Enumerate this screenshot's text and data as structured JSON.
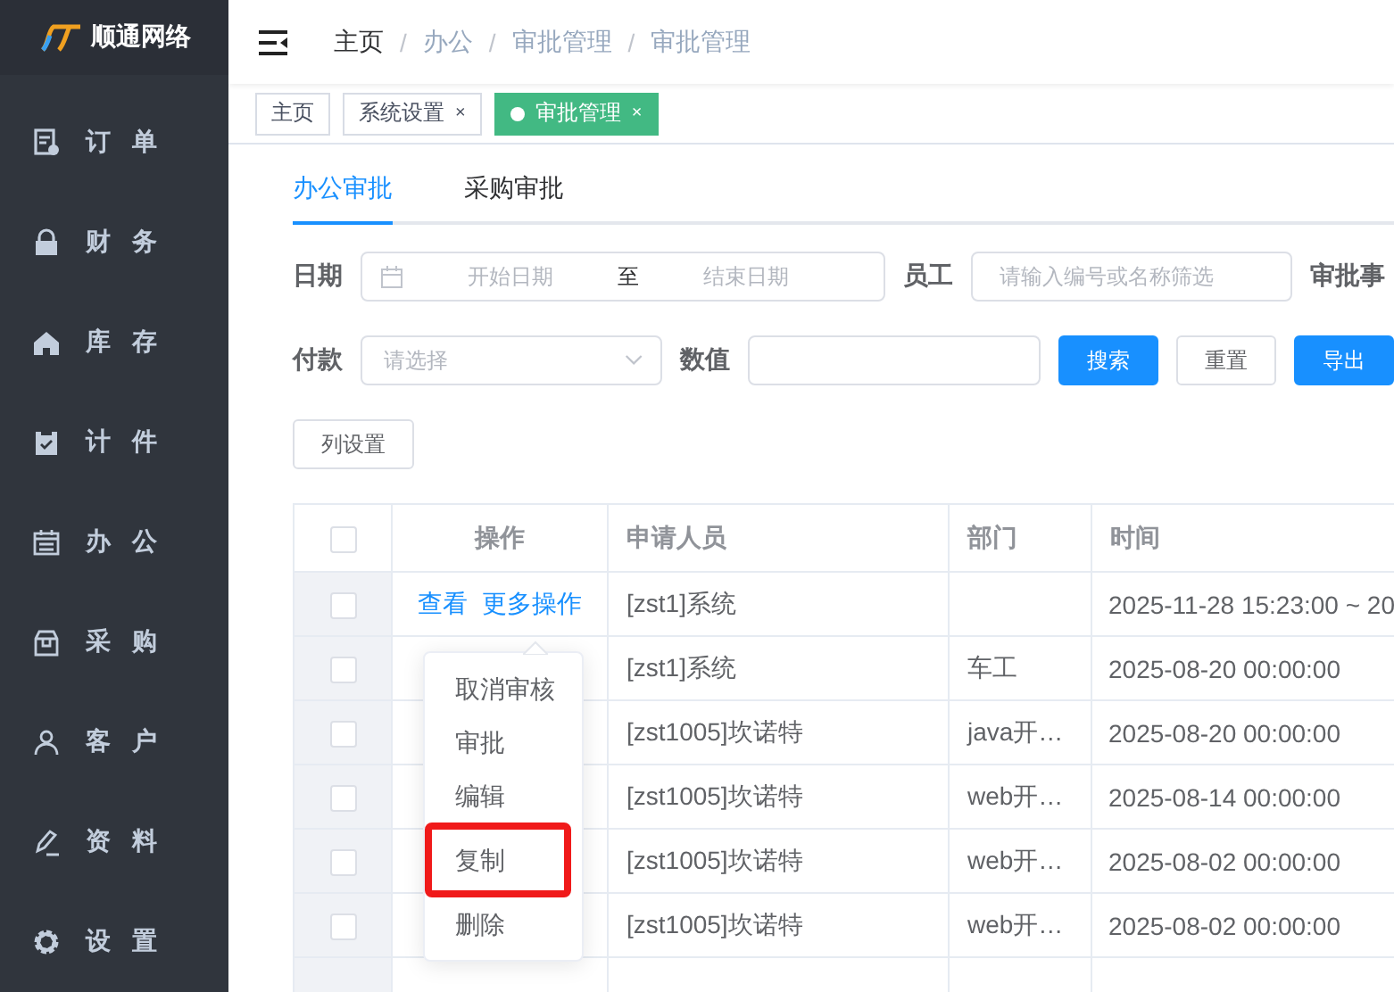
{
  "logo": {
    "text": "顺通网络"
  },
  "sidebar": {
    "items": [
      {
        "label": "订 单"
      },
      {
        "label": "财 务"
      },
      {
        "label": "库 存"
      },
      {
        "label": "计 件"
      },
      {
        "label": "办 公"
      },
      {
        "label": "采 购"
      },
      {
        "label": "客 户"
      },
      {
        "label": "资 料"
      },
      {
        "label": "设 置"
      }
    ]
  },
  "breadcrumb": [
    "主页",
    "办公",
    "审批管理",
    "审批管理"
  ],
  "breadcrumb_separator": "/",
  "page_tags": [
    {
      "label": "主页",
      "selected": false,
      "closable": false
    },
    {
      "label": "系统设置",
      "selected": false,
      "closable": true
    },
    {
      "label": "审批管理",
      "selected": true,
      "closable": true
    }
  ],
  "close_mark": "×",
  "tabs": [
    {
      "label": "办公审批",
      "selected": true
    },
    {
      "label": "采购审批",
      "selected": false
    }
  ],
  "filters": {
    "date_label": "日期",
    "date_start": {
      "placeholder": "开始日期"
    },
    "date_sep": "至",
    "date_end": {
      "placeholder": "结束日期"
    },
    "staff_label": "员工",
    "staff": {
      "placeholder": "请输入编号或名称筛选"
    },
    "approval_label": "审批事",
    "pay_label": "付款",
    "pay": {
      "placeholder": "请选择"
    },
    "value_label": "数值",
    "buttons": [
      {
        "label": "搜索",
        "kind": "primary"
      },
      {
        "label": "重置",
        "kind": "default"
      },
      {
        "label": "导出",
        "kind": "primary"
      }
    ]
  },
  "column_settings": "列设置",
  "table": {
    "columns": [
      "操作",
      "申请人员",
      "部门",
      "时间"
    ],
    "header_checked": false,
    "rows": [
      {
        "checked": false,
        "actions": [
          "查看",
          "更多操作"
        ],
        "applicant": "[zst1]系统",
        "dept": "",
        "time": "2025-11-28 15:23:00 ~ 20"
      },
      {
        "checked": false,
        "actions": [],
        "applicant": "[zst1]系统",
        "dept": "车工",
        "time": "2025-08-20 00:00:00"
      },
      {
        "checked": false,
        "actions": [],
        "applicant": "[zst1005]坎诺特",
        "dept": "java开…",
        "time": "2025-08-20 00:00:00"
      },
      {
        "checked": false,
        "actions": [],
        "applicant": "[zst1005]坎诺特",
        "dept": "web开…",
        "time": "2025-08-14 00:00:00"
      },
      {
        "checked": false,
        "actions": [],
        "applicant": "[zst1005]坎诺特",
        "dept": "web开…",
        "time": "2025-08-02 00:00:00"
      },
      {
        "checked": false,
        "actions": [],
        "applicant": "[zst1005]坎诺特",
        "dept": "web开…",
        "time": "2025-08-02 00:00:00"
      }
    ]
  },
  "more_menu": {
    "items": [
      {
        "label": "取消审核",
        "highlighted": false
      },
      {
        "label": "审批",
        "highlighted": false
      },
      {
        "label": "编辑",
        "highlighted": false
      },
      {
        "label": "复制",
        "highlighted": true
      },
      {
        "label": "删除",
        "highlighted": false
      }
    ]
  }
}
